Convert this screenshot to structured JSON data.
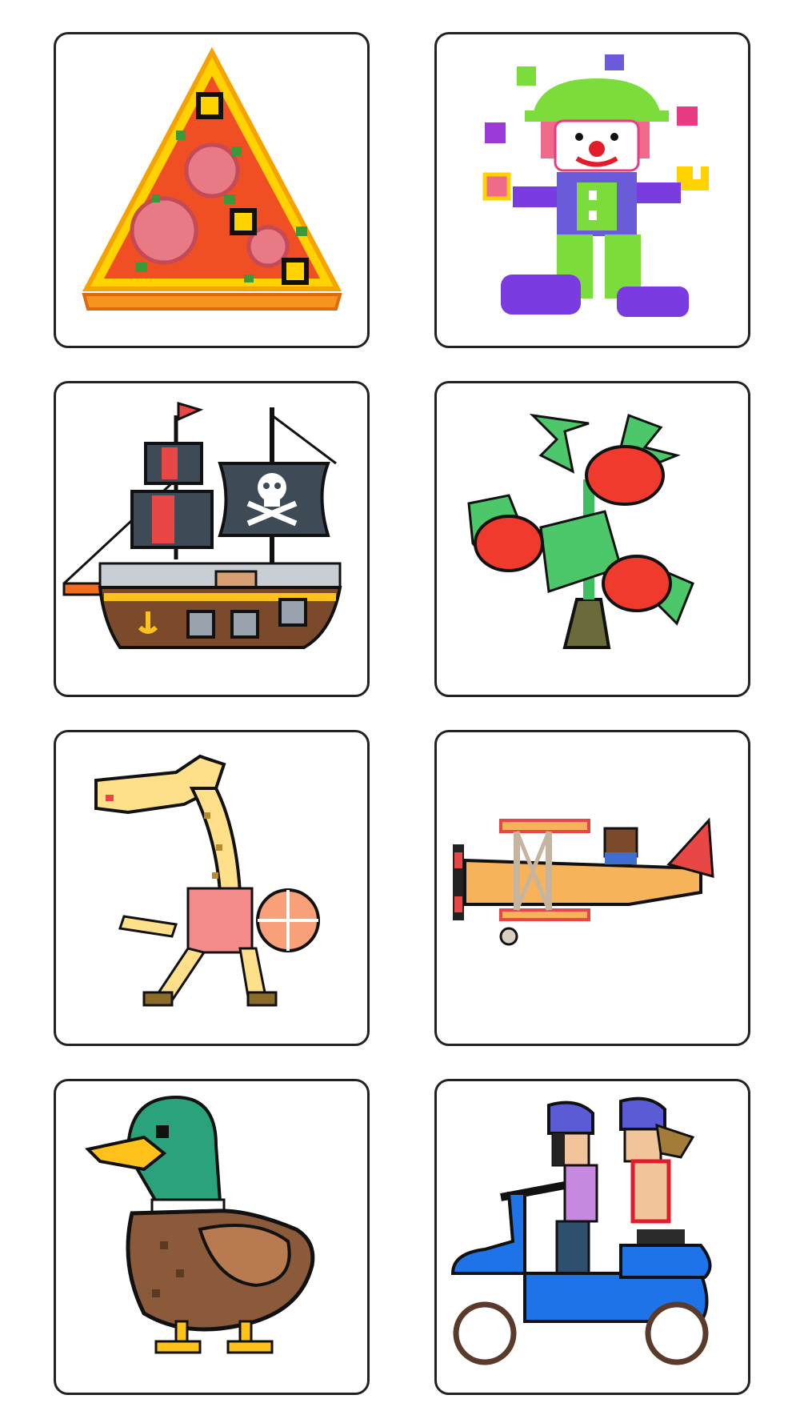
{
  "screen": "pixel-art-picture-grid",
  "cards": [
    {
      "subject": "pizza-slice",
      "icon": "pizza-icon"
    },
    {
      "subject": "juggling-clown",
      "icon": "clown-icon"
    },
    {
      "subject": "pirate-ship",
      "icon": "pirate-ship-icon"
    },
    {
      "subject": "tomato-plant",
      "icon": "tomato-plant-icon"
    },
    {
      "subject": "giraffe-basketball",
      "icon": "giraffe-icon"
    },
    {
      "subject": "biplane",
      "icon": "airplane-icon"
    },
    {
      "subject": "mallard-duck",
      "icon": "duck-icon"
    },
    {
      "subject": "scooter-riders",
      "icon": "scooter-icon"
    }
  ],
  "colors": {
    "card_border": "#222222",
    "background": "#ffffff"
  }
}
